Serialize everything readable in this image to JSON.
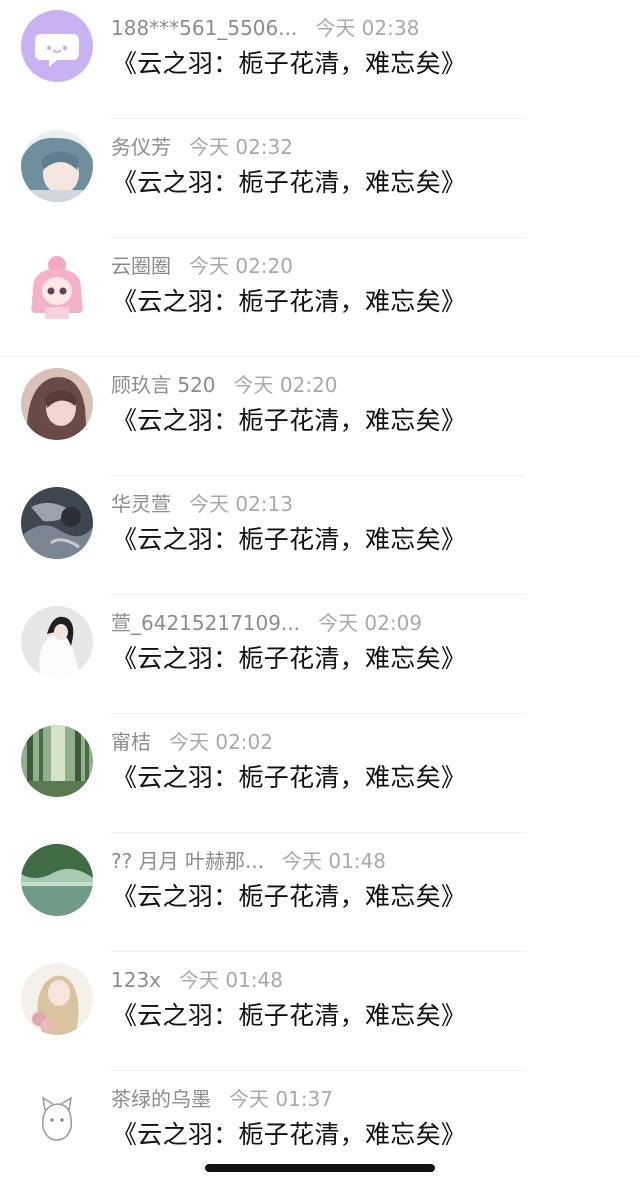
{
  "messages": [
    {
      "name": "188***561_5506...",
      "time": "今天 02:38",
      "text": "《云之羽：栀子花清，难忘矣》",
      "avatar": "purple-chat-icon-avatar"
    },
    {
      "name": "务仪芳",
      "time": "今天 02:32",
      "text": "《云之羽：栀子花清，难忘矣》",
      "avatar": "anime-girl-blue-hair-avatar"
    },
    {
      "name": "云圈圈",
      "time": "今天 02:20",
      "text": "《云之羽：栀子花清，难忘矣》",
      "avatar": "pink-chibi-girl-avatar"
    },
    {
      "name": "顾玖言 520",
      "time": "今天 02:20",
      "text": "《云之羽：栀子花清，难忘矣》",
      "avatar": "girl-photo-avatar"
    },
    {
      "name": "华灵萱",
      "time": "今天 02:13",
      "text": "《云之羽：栀子花清，难忘矣》",
      "avatar": "dark-photo-avatar"
    },
    {
      "name": "萱_64215217109...",
      "time": "今天 02:09",
      "text": "《云之羽：栀子花清，难忘矣》",
      "avatar": "girl-white-dress-avatar"
    },
    {
      "name": "甯桔",
      "time": "今天 02:02",
      "text": "《云之羽：栀子花清，难忘矣》",
      "avatar": "forest-avatar"
    },
    {
      "name": "?? 月月 叶赫那...",
      "time": "今天 01:48",
      "text": "《云之羽：栀子花清，难忘矣》",
      "avatar": "lake-landscape-avatar"
    },
    {
      "name": "123x",
      "time": "今天 01:48",
      "text": "《云之羽：栀子花清，难忘矣》",
      "avatar": "illustrated-girl-flowers-avatar"
    },
    {
      "name": "茶绿的乌墨",
      "time": "今天 01:37",
      "text": "《云之羽：栀子花清，难忘矣》",
      "avatar": "sketch-cat-avatar"
    }
  ],
  "colors": {
    "avatar_purple": "#c9b2f1",
    "name_gray": "#8c8c8c",
    "time_gray": "#a9a9a9",
    "text_black": "#111111",
    "divider": "#efefef"
  }
}
